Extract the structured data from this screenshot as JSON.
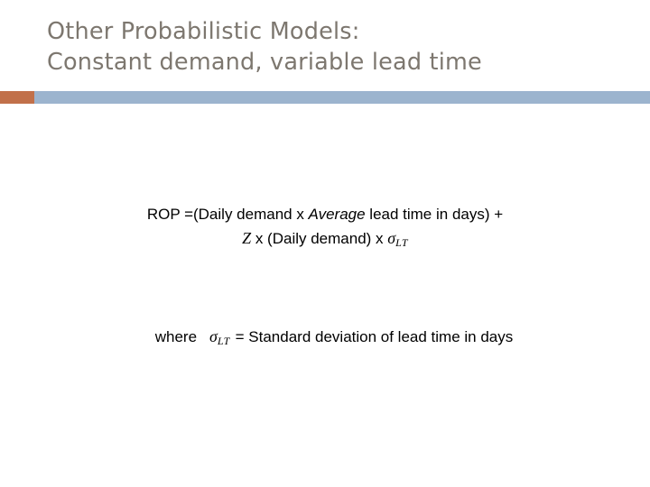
{
  "slide": {
    "title": {
      "line1": "Other Probabilistic Models:",
      "line2": "Constant demand, variable lead time"
    },
    "colors": {
      "title_text": "#7d776f",
      "divider_accent": "#c1704a",
      "divider_main": "#9cb4ce",
      "body_text": "#000000",
      "background": "#ffffff"
    },
    "body": {
      "formula": {
        "line1_part1": "ROP =(Daily demand x ",
        "line1_italic": "Average",
        "line1_part2": " lead time in days) +",
        "line2_z": "Z",
        "line2_part1": " x (Daily demand) x ",
        "line2_sigma": "σ",
        "line2_sigma_sub": "LT"
      },
      "where": {
        "label": "where",
        "sigma": "σ",
        "sigma_sub": "LT",
        "definition": "= Standard deviation of lead time in days"
      }
    }
  }
}
